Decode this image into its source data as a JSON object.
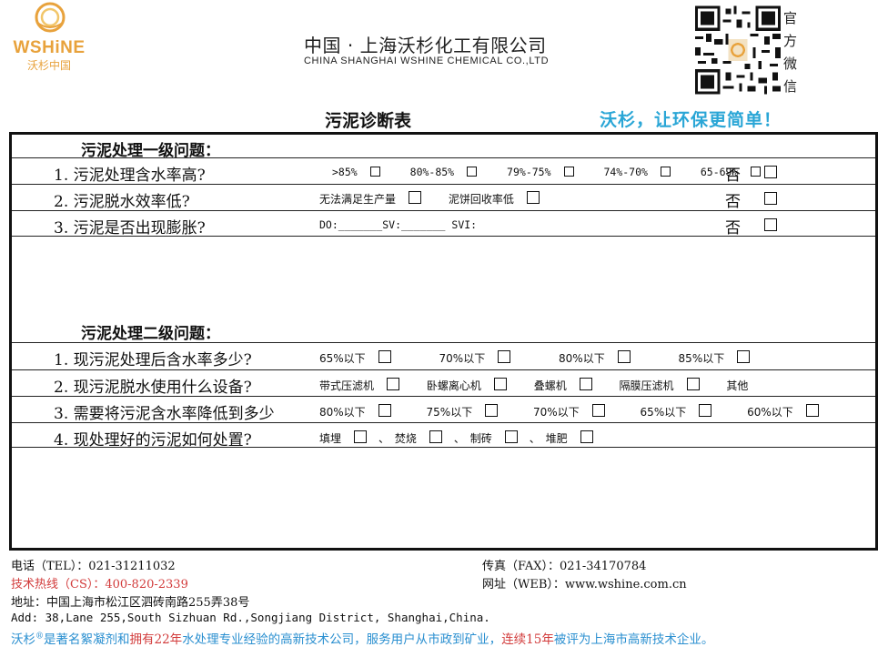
{
  "logo": {
    "wordmark": "WSHiNE",
    "cn": "沃杉中国",
    "color": "#e8a23c"
  },
  "company": {
    "cn": "中国 · 上海沃杉化工有限公司",
    "en": "CHINA SHANGHAI WSHINE CHEMICAL CO.,LTD"
  },
  "qr": {
    "label": [
      "官",
      "方",
      "微",
      "信"
    ]
  },
  "title": "污泥诊断表",
  "slogan": "沃杉，让环保更简单！",
  "section1": {
    "heading": "污泥处理一级问题：",
    "questions": [
      {
        "text": "1. 污泥处理含水率高?",
        "options": [
          ">85%",
          "80%-85%",
          "79%-75%",
          "74%-70%",
          "65-69%"
        ],
        "no": "否"
      },
      {
        "text": "2. 污泥脱水效率低?",
        "options": [
          "无法满足生产量",
          "泥饼回收率低"
        ],
        "no": "否"
      },
      {
        "text": "3. 污泥是否出现膨胀?",
        "fields": "DO:_______SV:_______ SVI:",
        "no": "否"
      }
    ]
  },
  "section2": {
    "heading": "污泥处理二级问题：",
    "questions": [
      {
        "text": "1. 现污泥处理后含水率多少?",
        "options": [
          "65%以下",
          "70%以下",
          "80%以下",
          "85%以下"
        ]
      },
      {
        "text": "2. 现污泥脱水使用什么设备?",
        "options": [
          "带式压滤机",
          "卧螺离心机",
          "叠螺机",
          "隔膜压滤机"
        ],
        "other": "其他"
      },
      {
        "text": "3. 需要将污泥含水率降低到多少",
        "options": [
          "80%以下",
          "75%以下",
          "70%以下",
          "65%以下",
          "60%以下"
        ]
      },
      {
        "text": "4. 现处理好的污泥如何处置?",
        "options": [
          "填埋",
          "焚烧",
          "制砖",
          "堆肥"
        ]
      }
    ]
  },
  "footer": {
    "tel": "电话（TEL）：021-31211032",
    "fax": "传真（FAX）：021-34170784",
    "hotline": "技术热线（CS）：400-820-2339",
    "web": "网址（WEB）：www.wshine.com.cn",
    "address_cn": "地址：中国上海市松江区泗砖南路255弄38号",
    "address_en": "Add: 38,Lane 255,South Sizhuan Rd.,Songjiang District, Shanghai,China.",
    "tagline_a": "沃杉",
    "tagline_b": "是著名絮凝剂和",
    "tagline_c": "拥有22年",
    "tagline_d": "水处理专业经验的高新技术公司，服务用户从市政到矿业，",
    "tagline_e": "连续15年",
    "tagline_f": "被评为上海市高新技术企业。"
  }
}
